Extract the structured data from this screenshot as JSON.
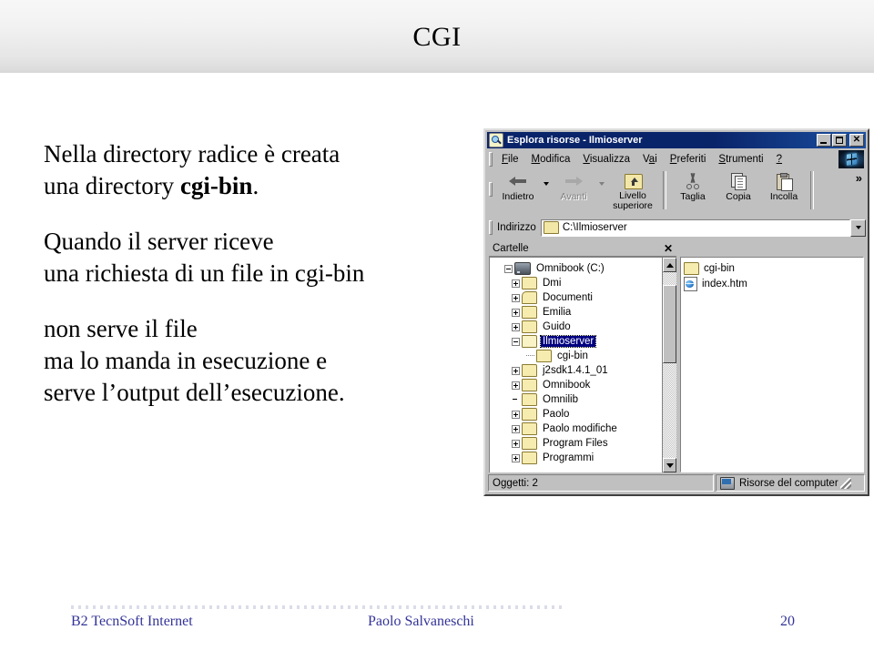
{
  "slide": {
    "title": "CGI",
    "body": [
      {
        "id": "p1",
        "html_parts": [
          {
            "t": "Nella directory radice è creata\nuna directory ",
            "bold": false
          },
          {
            "t": "cgi-bin",
            "bold": true
          },
          {
            "t": ".",
            "bold": false
          }
        ],
        "text": "Nella directory radice è creata una directory cgi-bin."
      },
      {
        "id": "p2",
        "text": "Quando il server riceve\nuna richiesta di un file in cgi-bin"
      },
      {
        "id": "p3",
        "text": "non serve il file\nma lo manda in esecuzione e\nserve l’output dell’esecuzione."
      }
    ],
    "body_line1": "Nella directory radice è creata",
    "body_line2a": "una directory ",
    "body_line2b": "cgi-bin",
    "body_line2c": ".",
    "body_line3": "Quando il server riceve",
    "body_line4": "una richiesta di un file in cgi-bin",
    "body_line5": "non serve il file",
    "body_line6": "ma lo manda in esecuzione e",
    "body_line7": "serve l’output dell’esecuzione."
  },
  "footer": {
    "left": "B2 TecnSoft Internet",
    "center": "Paolo Salvaneschi",
    "page_number": "20",
    "color": "#333399"
  },
  "explorer": {
    "title": "Esplora risorse - Ilmioserver",
    "window_buttons": {
      "minimize": "_",
      "maximize": "□",
      "close": "✕"
    },
    "menu": [
      {
        "pre": "",
        "accel": "F",
        "post": "ile"
      },
      {
        "pre": "",
        "accel": "M",
        "post": "odifica"
      },
      {
        "pre": "",
        "accel": "V",
        "post": "isualizza"
      },
      {
        "pre": "V",
        "accel": "a",
        "post": "i"
      },
      {
        "pre": "",
        "accel": "P",
        "post": "referiti"
      },
      {
        "pre": "",
        "accel": "S",
        "post": "trumenti"
      },
      {
        "pre": "",
        "accel": "?",
        "post": ""
      }
    ],
    "toolbar": [
      {
        "label": "Indietro",
        "icon": "back-arrow-icon",
        "disabled": false,
        "dropdown": true
      },
      {
        "label": "Avanti",
        "icon": "forward-arrow-icon",
        "disabled": true,
        "dropdown": true
      },
      {
        "label": "Livello\nsuperiore",
        "icon": "up-one-level-icon",
        "disabled": false,
        "dropdown": false
      },
      {
        "label": "Taglia",
        "icon": "scissors-icon",
        "disabled": false,
        "dropdown": false
      },
      {
        "label": "Copia",
        "icon": "copy-pages-icon",
        "disabled": false,
        "dropdown": false
      },
      {
        "label": "Incolla",
        "icon": "clipboard-paste-icon",
        "disabled": false,
        "dropdown": false
      }
    ],
    "toolbar_overflow": "»",
    "address": {
      "label": "Indirizzo",
      "value": "C:\\Ilmioserver"
    },
    "folders_pane": {
      "title": "Cartelle",
      "close": "✕"
    },
    "tree": [
      {
        "label": "Omnibook (C:)",
        "level": 0,
        "expander": "minus",
        "icon": "drive-icon",
        "selected": false
      },
      {
        "label": "Dmi",
        "level": 1,
        "expander": "plus",
        "icon": "folder-icon",
        "selected": false
      },
      {
        "label": "Documenti",
        "level": 1,
        "expander": "plus",
        "icon": "documents-folder-icon",
        "selected": false
      },
      {
        "label": "Emilia",
        "level": 1,
        "expander": "plus",
        "icon": "folder-icon",
        "selected": false
      },
      {
        "label": "Guido",
        "level": 1,
        "expander": "plus",
        "icon": "folder-icon",
        "selected": false
      },
      {
        "label": "Ilmioserver",
        "level": 1,
        "expander": "minus",
        "icon": "open-folder-icon",
        "selected": true
      },
      {
        "label": "cgi-bin",
        "level": 2,
        "expander": "none",
        "icon": "folder-icon",
        "selected": false
      },
      {
        "label": "j2sdk1.4.1_01",
        "level": 1,
        "expander": "plus",
        "icon": "folder-icon",
        "selected": false
      },
      {
        "label": "Omnibook",
        "level": 1,
        "expander": "plus",
        "icon": "folder-icon",
        "selected": false
      },
      {
        "label": "Omnilib",
        "level": 1,
        "expander": "none",
        "icon": "folder-icon",
        "selected": false
      },
      {
        "label": "Paolo",
        "level": 1,
        "expander": "plus",
        "icon": "folder-icon",
        "selected": false
      },
      {
        "label": "Paolo modifiche",
        "level": 1,
        "expander": "plus",
        "icon": "folder-icon",
        "selected": false
      },
      {
        "label": "Program Files",
        "level": 1,
        "expander": "plus",
        "icon": "folder-icon",
        "selected": false
      },
      {
        "label": "Programmi",
        "level": 1,
        "expander": "plus",
        "icon": "folder-icon",
        "selected": false
      }
    ],
    "files": [
      {
        "name": "cgi-bin",
        "icon": "folder-icon"
      },
      {
        "name": "index.htm",
        "icon": "html-document-icon"
      }
    ],
    "status": {
      "objects": "Oggetti: 2",
      "zone": "Risorse del computer"
    },
    "colors": {
      "titlebar": "#0A246A",
      "chrome": "#C0C0C0",
      "selection": "#000080",
      "folder": "#F7ECB0"
    }
  }
}
